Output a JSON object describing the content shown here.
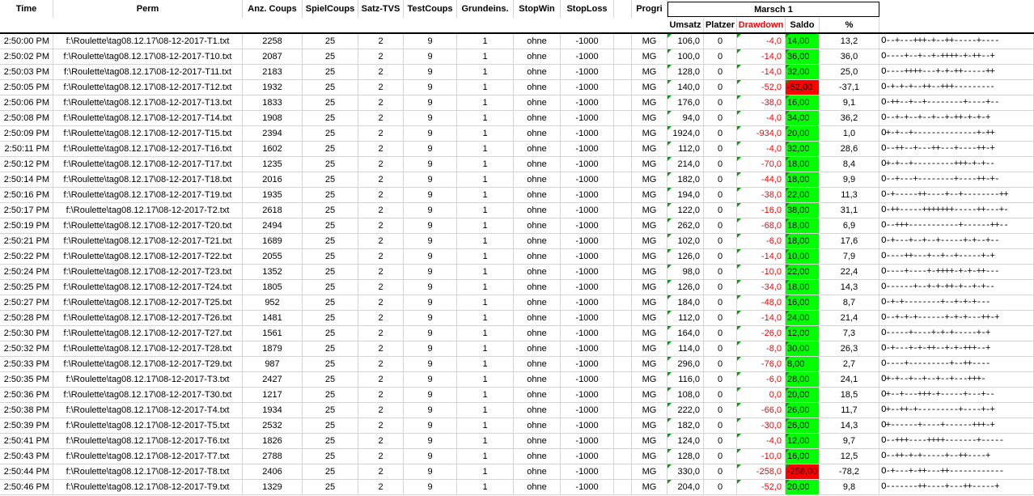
{
  "headers": {
    "time": "Time",
    "perm": "Perm",
    "anz_coups": "Anz. Coups",
    "spielcoups": "SpielCoups",
    "satz_tvs": "Satz-TVS",
    "testcoups": "TestCoups",
    "grundeins": "Grundeins.",
    "stopwin": "StopWin",
    "stoploss": "StopLoss",
    "progri": "Progri",
    "group": "Marsch 1",
    "umsatz": "Umsatz",
    "platzer": "Platzer",
    "drawdown": "Drawdown",
    "saldo": "Saldo",
    "percent": "%"
  },
  "colors": {
    "saldo_positive": "#00ff00",
    "saldo_negative": "#ff0000",
    "drawdown_text": "#ff0000",
    "comment_marker": "#00a000"
  },
  "rows": [
    {
      "time": "2:50:00 PM",
      "perm": "f:\\Roulette\\tag08.12.17\\08-12-2017-T1.txt",
      "anz": "2258",
      "spiel": "25",
      "satz": "2",
      "test": "9",
      "grund": "1",
      "stopwin": "ohne",
      "stoploss": "-1000",
      "progri": "MG",
      "umsatz": "106,0",
      "platzer": "0",
      "drawdown": "-4,0",
      "saldo": "14,00",
      "saldo_neg": false,
      "pct": "13,2",
      "pattern": "O--+---+++-+--++-----+----"
    },
    {
      "time": "2:50:02 PM",
      "perm": "f:\\Roulette\\tag08.12.17\\08-12-2017-T10.txt",
      "anz": "2087",
      "spiel": "25",
      "satz": "2",
      "test": "9",
      "grund": "1",
      "stopwin": "ohne",
      "stoploss": "-1000",
      "progri": "MG",
      "umsatz": "100,0",
      "platzer": "0",
      "drawdown": "-14,0",
      "saldo": "36,00",
      "saldo_neg": false,
      "pct": "36,0",
      "pattern": "O----+--+--+-++++-+-++--+"
    },
    {
      "time": "2:50:03 PM",
      "perm": "f:\\Roulette\\tag08.12.17\\08-12-2017-T11.txt",
      "anz": "2183",
      "spiel": "25",
      "satz": "2",
      "test": "9",
      "grund": "1",
      "stopwin": "ohne",
      "stoploss": "-1000",
      "progri": "MG",
      "umsatz": "128,0",
      "platzer": "0",
      "drawdown": "-14,0",
      "saldo": "32,00",
      "saldo_neg": false,
      "pct": "25,0",
      "pattern": "O----++++---+-+-++-----++"
    },
    {
      "time": "2:50:05 PM",
      "perm": "f:\\Roulette\\tag08.12.17\\08-12-2017-T12.txt",
      "anz": "1932",
      "spiel": "25",
      "satz": "2",
      "test": "9",
      "grund": "1",
      "stopwin": "ohne",
      "stoploss": "-1000",
      "progri": "MG",
      "umsatz": "140,0",
      "platzer": "0",
      "drawdown": "-52,0",
      "saldo": "-52,00",
      "saldo_neg": true,
      "pct": "-37,1",
      "pattern": "O-+-+-+--++--+++---------"
    },
    {
      "time": "2:50:06 PM",
      "perm": "f:\\Roulette\\tag08.12.17\\08-12-2017-T13.txt",
      "anz": "1833",
      "spiel": "25",
      "satz": "2",
      "test": "9",
      "grund": "1",
      "stopwin": "ohne",
      "stoploss": "-1000",
      "progri": "MG",
      "umsatz": "176,0",
      "platzer": "0",
      "drawdown": "-38,0",
      "saldo": "16,00",
      "saldo_neg": false,
      "pct": "9,1",
      "pattern": "O-++--+--+--------+----+--"
    },
    {
      "time": "2:50:08 PM",
      "perm": "f:\\Roulette\\tag08.12.17\\08-12-2017-T14.txt",
      "anz": "1908",
      "spiel": "25",
      "satz": "2",
      "test": "9",
      "grund": "1",
      "stopwin": "ohne",
      "stoploss": "-1000",
      "progri": "MG",
      "umsatz": "94,0",
      "platzer": "0",
      "drawdown": "-4,0",
      "saldo": "34,00",
      "saldo_neg": false,
      "pct": "36,2",
      "pattern": "O--+-+--+--+--+-++-+-+-+"
    },
    {
      "time": "2:50:09 PM",
      "perm": "f:\\Roulette\\tag08.12.17\\08-12-2017-T15.txt",
      "anz": "2394",
      "spiel": "25",
      "satz": "2",
      "test": "9",
      "grund": "1",
      "stopwin": "ohne",
      "stoploss": "-1000",
      "progri": "MG",
      "umsatz": "1924,0",
      "platzer": "0",
      "drawdown": "-934,0",
      "saldo": "20,00",
      "saldo_neg": false,
      "pct": "1,0",
      "pattern": "O+-+--+--------------+-++"
    },
    {
      "time": "2:50:11 PM",
      "perm": "f:\\Roulette\\tag08.12.17\\08-12-2017-T16.txt",
      "anz": "1602",
      "spiel": "25",
      "satz": "2",
      "test": "9",
      "grund": "1",
      "stopwin": "ohne",
      "stoploss": "-1000",
      "progri": "MG",
      "umsatz": "112,0",
      "platzer": "0",
      "drawdown": "-4,0",
      "saldo": "32,00",
      "saldo_neg": false,
      "pct": "28,6",
      "pattern": "O--++--+---++---+----++-+"
    },
    {
      "time": "2:50:12 PM",
      "perm": "f:\\Roulette\\tag08.12.17\\08-12-2017-T17.txt",
      "anz": "1235",
      "spiel": "25",
      "satz": "2",
      "test": "9",
      "grund": "1",
      "stopwin": "ohne",
      "stoploss": "-1000",
      "progri": "MG",
      "umsatz": "214,0",
      "platzer": "0",
      "drawdown": "-70,0",
      "saldo": "18,00",
      "saldo_neg": false,
      "pct": "8,4",
      "pattern": "O+-+--+---------+++-+-+--"
    },
    {
      "time": "2:50:14 PM",
      "perm": "f:\\Roulette\\tag08.12.17\\08-12-2017-T18.txt",
      "anz": "2016",
      "spiel": "25",
      "satz": "2",
      "test": "9",
      "grund": "1",
      "stopwin": "ohne",
      "stoploss": "-1000",
      "progri": "MG",
      "umsatz": "182,0",
      "platzer": "0",
      "drawdown": "-44,0",
      "saldo": "18,00",
      "saldo_neg": false,
      "pct": "9,9",
      "pattern": "O--+---+--------+----++-+-"
    },
    {
      "time": "2:50:16 PM",
      "perm": "f:\\Roulette\\tag08.12.17\\08-12-2017-T19.txt",
      "anz": "1935",
      "spiel": "25",
      "satz": "2",
      "test": "9",
      "grund": "1",
      "stopwin": "ohne",
      "stoploss": "-1000",
      "progri": "MG",
      "umsatz": "194,0",
      "platzer": "0",
      "drawdown": "-38,0",
      "saldo": "22,00",
      "saldo_neg": false,
      "pct": "11,3",
      "pattern": "O-+-----++----+--+--------++"
    },
    {
      "time": "2:50:17 PM",
      "perm": "f:\\Roulette\\tag08.12.17\\08-12-2017-T2.txt",
      "anz": "2618",
      "spiel": "25",
      "satz": "2",
      "test": "9",
      "grund": "1",
      "stopwin": "ohne",
      "stoploss": "-1000",
      "progri": "MG",
      "umsatz": "122,0",
      "platzer": "0",
      "drawdown": "-16,0",
      "saldo": "38,00",
      "saldo_neg": false,
      "pct": "31,1",
      "pattern": "O-++-----+++++++-----++---+-"
    },
    {
      "time": "2:50:19 PM",
      "perm": "f:\\Roulette\\tag08.12.17\\08-12-2017-T20.txt",
      "anz": "2494",
      "spiel": "25",
      "satz": "2",
      "test": "9",
      "grund": "1",
      "stopwin": "ohne",
      "stoploss": "-1000",
      "progri": "MG",
      "umsatz": "262,0",
      "platzer": "0",
      "drawdown": "-68,0",
      "saldo": "18,00",
      "saldo_neg": false,
      "pct": "6,9",
      "pattern": "O--+++-----------+------++--"
    },
    {
      "time": "2:50:21 PM",
      "perm": "f:\\Roulette\\tag08.12.17\\08-12-2017-T21.txt",
      "anz": "1689",
      "spiel": "25",
      "satz": "2",
      "test": "9",
      "grund": "1",
      "stopwin": "ohne",
      "stoploss": "-1000",
      "progri": "MG",
      "umsatz": "102,0",
      "platzer": "0",
      "drawdown": "-6,0",
      "saldo": "18,00",
      "saldo_neg": false,
      "pct": "17,6",
      "pattern": "O-+---+--+--+-----+-+--+--"
    },
    {
      "time": "2:50:22 PM",
      "perm": "f:\\Roulette\\tag08.12.17\\08-12-2017-T22.txt",
      "anz": "2055",
      "spiel": "25",
      "satz": "2",
      "test": "9",
      "grund": "1",
      "stopwin": "ohne",
      "stoploss": "-1000",
      "progri": "MG",
      "umsatz": "126,0",
      "platzer": "0",
      "drawdown": "-14,0",
      "saldo": "10,00",
      "saldo_neg": false,
      "pct": "7,9",
      "pattern": "O----++---+--+--+-----+-+"
    },
    {
      "time": "2:50:24 PM",
      "perm": "f:\\Roulette\\tag08.12.17\\08-12-2017-T23.txt",
      "anz": "1352",
      "spiel": "25",
      "satz": "2",
      "test": "9",
      "grund": "1",
      "stopwin": "ohne",
      "stoploss": "-1000",
      "progri": "MG",
      "umsatz": "98,0",
      "platzer": "0",
      "drawdown": "-10,0",
      "saldo": "22,00",
      "saldo_neg": false,
      "pct": "22,4",
      "pattern": "O----+----+-++++-+-+-++---"
    },
    {
      "time": "2:50:25 PM",
      "perm": "f:\\Roulette\\tag08.12.17\\08-12-2017-T24.txt",
      "anz": "1805",
      "spiel": "25",
      "satz": "2",
      "test": "9",
      "grund": "1",
      "stopwin": "ohne",
      "stoploss": "-1000",
      "progri": "MG",
      "umsatz": "126,0",
      "platzer": "0",
      "drawdown": "-34,0",
      "saldo": "18,00",
      "saldo_neg": false,
      "pct": "14,3",
      "pattern": "O------+--+-+-++-+--+-+--"
    },
    {
      "time": "2:50:27 PM",
      "perm": "f:\\Roulette\\tag08.12.17\\08-12-2017-T25.txt",
      "anz": "952",
      "spiel": "25",
      "satz": "2",
      "test": "9",
      "grund": "1",
      "stopwin": "ohne",
      "stoploss": "-1000",
      "progri": "MG",
      "umsatz": "184,0",
      "platzer": "0",
      "drawdown": "-48,0",
      "saldo": "16,00",
      "saldo_neg": false,
      "pct": "8,7",
      "pattern": "O-+-+--------+--+-+-+---"
    },
    {
      "time": "2:50:28 PM",
      "perm": "f:\\Roulette\\tag08.12.17\\08-12-2017-T26.txt",
      "anz": "1481",
      "spiel": "25",
      "satz": "2",
      "test": "9",
      "grund": "1",
      "stopwin": "ohne",
      "stoploss": "-1000",
      "progri": "MG",
      "umsatz": "112,0",
      "platzer": "0",
      "drawdown": "-14,0",
      "saldo": "24,00",
      "saldo_neg": false,
      "pct": "21,4",
      "pattern": "O--+-+-+------+-+-+---++-+"
    },
    {
      "time": "2:50:30 PM",
      "perm": "f:\\Roulette\\tag08.12.17\\08-12-2017-T27.txt",
      "anz": "1561",
      "spiel": "25",
      "satz": "2",
      "test": "9",
      "grund": "1",
      "stopwin": "ohne",
      "stoploss": "-1000",
      "progri": "MG",
      "umsatz": "164,0",
      "platzer": "0",
      "drawdown": "-26,0",
      "saldo": "12,00",
      "saldo_neg": false,
      "pct": "7,3",
      "pattern": "O-----+----+-+-+-----+-+"
    },
    {
      "time": "2:50:32 PM",
      "perm": "f:\\Roulette\\tag08.12.17\\08-12-2017-T28.txt",
      "anz": "1879",
      "spiel": "25",
      "satz": "2",
      "test": "9",
      "grund": "1",
      "stopwin": "ohne",
      "stoploss": "-1000",
      "progri": "MG",
      "umsatz": "114,0",
      "platzer": "0",
      "drawdown": "-8,0",
      "saldo": "30,00",
      "saldo_neg": false,
      "pct": "26,3",
      "pattern": "O-+---+-+-++--+-+-+++--+"
    },
    {
      "time": "2:50:33 PM",
      "perm": "f:\\Roulette\\tag08.12.17\\08-12-2017-T29.txt",
      "anz": "987",
      "spiel": "25",
      "satz": "2",
      "test": "9",
      "grund": "1",
      "stopwin": "ohne",
      "stoploss": "-1000",
      "progri": "MG",
      "umsatz": "296,0",
      "platzer": "0",
      "drawdown": "-76,0",
      "saldo": "8,00",
      "saldo_neg": false,
      "pct": "2,7",
      "pattern": "O----+---------+--++----"
    },
    {
      "time": "2:50:35 PM",
      "perm": "f:\\Roulette\\tag08.12.17\\08-12-2017-T3.txt",
      "anz": "2427",
      "spiel": "25",
      "satz": "2",
      "test": "9",
      "grund": "1",
      "stopwin": "ohne",
      "stoploss": "-1000",
      "progri": "MG",
      "umsatz": "116,0",
      "platzer": "0",
      "drawdown": "-6,0",
      "saldo": "28,00",
      "saldo_neg": false,
      "pct": "24,1",
      "pattern": "O+-+--+--+--+--+---+++-"
    },
    {
      "time": "2:50:36 PM",
      "perm": "f:\\Roulette\\tag08.12.17\\08-12-2017-T30.txt",
      "anz": "1217",
      "spiel": "25",
      "satz": "2",
      "test": "9",
      "grund": "1",
      "stopwin": "ohne",
      "stoploss": "-1000",
      "progri": "MG",
      "umsatz": "108,0",
      "platzer": "0",
      "drawdown": "0,0",
      "saldo": "20,00",
      "saldo_neg": false,
      "pct": "18,5",
      "pattern": "O+--+---+++-+-----+---+--"
    },
    {
      "time": "2:50:38 PM",
      "perm": "f:\\Roulette\\tag08.12.17\\08-12-2017-T4.txt",
      "anz": "1934",
      "spiel": "25",
      "satz": "2",
      "test": "9",
      "grund": "1",
      "stopwin": "ohne",
      "stoploss": "-1000",
      "progri": "MG",
      "umsatz": "222,0",
      "platzer": "0",
      "drawdown": "-66,0",
      "saldo": "26,00",
      "saldo_neg": false,
      "pct": "11,7",
      "pattern": "O+--++-+---------+----+-+"
    },
    {
      "time": "2:50:39 PM",
      "perm": "f:\\Roulette\\tag08.12.17\\08-12-2017-T5.txt",
      "anz": "2532",
      "spiel": "25",
      "satz": "2",
      "test": "9",
      "grund": "1",
      "stopwin": "ohne",
      "stoploss": "-1000",
      "progri": "MG",
      "umsatz": "182,0",
      "platzer": "0",
      "drawdown": "-30,0",
      "saldo": "26,00",
      "saldo_neg": false,
      "pct": "14,3",
      "pattern": "O+------+----+------+++-+"
    },
    {
      "time": "2:50:41 PM",
      "perm": "f:\\Roulette\\tag08.12.17\\08-12-2017-T6.txt",
      "anz": "1826",
      "spiel": "25",
      "satz": "2",
      "test": "9",
      "grund": "1",
      "stopwin": "ohne",
      "stoploss": "-1000",
      "progri": "MG",
      "umsatz": "124,0",
      "platzer": "0",
      "drawdown": "-4,0",
      "saldo": "12,00",
      "saldo_neg": false,
      "pct": "9,7",
      "pattern": "O--+++----++++-------+-----"
    },
    {
      "time": "2:50:43 PM",
      "perm": "f:\\Roulette\\tag08.12.17\\08-12-2017-T7.txt",
      "anz": "2788",
      "spiel": "25",
      "satz": "2",
      "test": "9",
      "grund": "1",
      "stopwin": "ohne",
      "stoploss": "-1000",
      "progri": "MG",
      "umsatz": "128,0",
      "platzer": "0",
      "drawdown": "-10,0",
      "saldo": "16,00",
      "saldo_neg": false,
      "pct": "12,5",
      "pattern": "O--++-+-+-----+--++----+"
    },
    {
      "time": "2:50:44 PM",
      "perm": "f:\\Roulette\\tag08.12.17\\08-12-2017-T8.txt",
      "anz": "2406",
      "spiel": "25",
      "satz": "2",
      "test": "9",
      "grund": "1",
      "stopwin": "ohne",
      "stoploss": "-1000",
      "progri": "MG",
      "umsatz": "330,0",
      "platzer": "0",
      "drawdown": "-258,0",
      "saldo": "-258,00",
      "saldo_neg": true,
      "pct": "-78,2",
      "pattern": "O-+---+-++---++------------"
    },
    {
      "time": "2:50:46 PM",
      "perm": "f:\\Roulette\\tag08.12.17\\08-12-2017-T9.txt",
      "anz": "1329",
      "spiel": "25",
      "satz": "2",
      "test": "9",
      "grund": "1",
      "stopwin": "ohne",
      "stoploss": "-1000",
      "progri": "MG",
      "umsatz": "204,0",
      "platzer": "0",
      "drawdown": "-52,0",
      "saldo": "20,00",
      "saldo_neg": false,
      "pct": "9,8",
      "pattern": "O-------++----+---++-----+"
    }
  ]
}
